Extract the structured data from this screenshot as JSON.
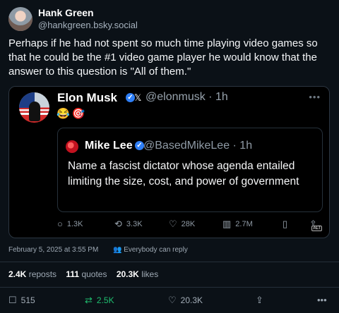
{
  "post": {
    "author_name": "Hank Green",
    "author_handle": "@hankgreen.bsky.social",
    "text": "Perhaps if he had not spent so much time playing video games so that he could be the #1 video game player he would know that the answer to this question is \"All of them.\"",
    "timestamp": "February 5, 2025 at 3:55 PM",
    "reply_setting": "Everybody can reply",
    "counts": {
      "reposts": "2.4K",
      "reposts_label": "reposts",
      "quotes": "111",
      "quotes_label": "quotes",
      "likes": "20.3K",
      "likes_label": "likes"
    },
    "actions": {
      "replies": "515",
      "reposts": "2.5K",
      "likes": "20.3K"
    },
    "colors": {
      "background": "#0b1117",
      "repost_accent": "#1fbf6f"
    }
  },
  "embed": {
    "author_name": "Elon Musk",
    "handle": "@elonmusk · 1h",
    "emoji": "😂🎯",
    "quote": {
      "author_name": "Mike Lee",
      "handle": "@BasedMikeLee · 1h",
      "text": "Name a fascist dictator whose agenda entailed limiting the size, cost, and power of government"
    },
    "stats": {
      "replies": "1.3K",
      "reposts": "3.3K",
      "likes": "28K",
      "views": "2.7M",
      "alt": "ALT"
    }
  }
}
